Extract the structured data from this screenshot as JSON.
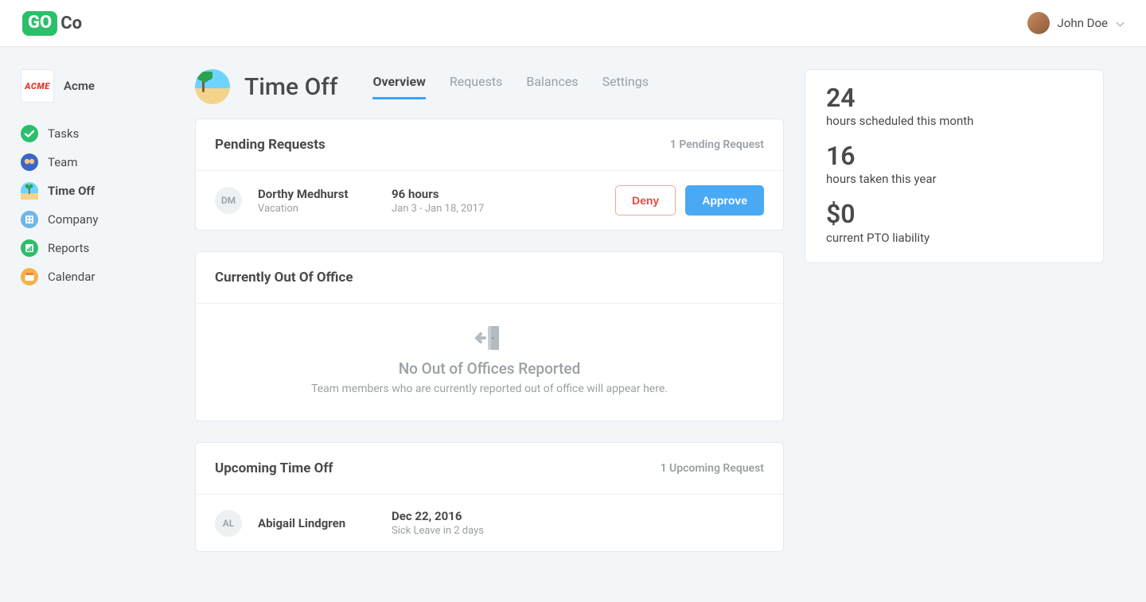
{
  "header": {
    "logo_badge": "GO",
    "logo_text": "Co",
    "user_name": "John Doe"
  },
  "sidebar": {
    "company_badge": "ACME",
    "company_name": "Acme",
    "items": [
      {
        "label": "Tasks",
        "icon": "tasks",
        "active": false
      },
      {
        "label": "Team",
        "icon": "team",
        "active": false
      },
      {
        "label": "Time Off",
        "icon": "timeoff",
        "active": true
      },
      {
        "label": "Company",
        "icon": "company",
        "active": false
      },
      {
        "label": "Reports",
        "icon": "reports",
        "active": false
      },
      {
        "label": "Calendar",
        "icon": "calendar",
        "active": false
      }
    ]
  },
  "page": {
    "title": "Time Off",
    "tabs": [
      {
        "label": "Overview",
        "active": true
      },
      {
        "label": "Requests",
        "active": false
      },
      {
        "label": "Balances",
        "active": false
      },
      {
        "label": "Settings",
        "active": false
      }
    ]
  },
  "pending": {
    "title": "Pending Requests",
    "meta": "1 Pending Request",
    "request": {
      "initials": "DM",
      "name": "Dorthy Medhurst",
      "type": "Vacation",
      "hours": "96 hours",
      "dates": "Jan 3 - Jan 18, 2017",
      "deny_label": "Deny",
      "approve_label": "Approve"
    }
  },
  "out_of_office": {
    "title": "Currently Out Of Office",
    "empty_title": "No Out of Offices Reported",
    "empty_sub": "Team members who are currently reported out of office will appear here."
  },
  "upcoming": {
    "title": "Upcoming Time Off",
    "meta": "1 Upcoming Request",
    "item": {
      "initials": "AL",
      "name": "Abigail Lindgren",
      "date": "Dec 22, 2016",
      "sub": "Sick Leave in 2 days"
    }
  },
  "stats": [
    {
      "value": "24",
      "label": "hours scheduled this month"
    },
    {
      "value": "16",
      "label": "hours taken this year"
    },
    {
      "value": "$0",
      "label": "current PTO liability"
    }
  ]
}
